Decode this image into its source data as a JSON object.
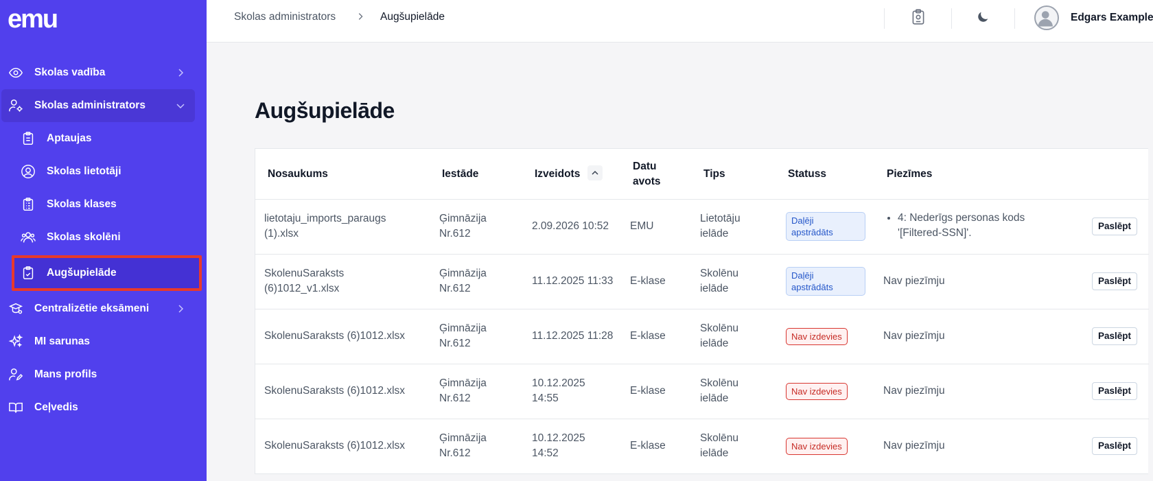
{
  "app": {
    "logo_text": "emu"
  },
  "sidebar": {
    "items": [
      {
        "label": "Skolas vadība",
        "icon": "eye-icon"
      },
      {
        "label": "Skolas administrators",
        "icon": "user-gear-icon"
      },
      {
        "label": "Aptaujas",
        "icon": "clipboard-icon"
      },
      {
        "label": "Skolas lietotāji",
        "icon": "user-circle-icon"
      },
      {
        "label": "Skolas klases",
        "icon": "clipboard-list-icon"
      },
      {
        "label": "Skolas skolēni",
        "icon": "users-icon"
      },
      {
        "label": "Augšupielāde",
        "icon": "clipboard-check-icon"
      },
      {
        "label": "Centralizētie eksāmeni",
        "icon": "exam-icon"
      },
      {
        "label": "MI sarunas",
        "icon": "sparkles-icon"
      },
      {
        "label": "Mans profils",
        "icon": "user-edit-icon"
      },
      {
        "label": "Ceļvedis",
        "icon": "book-icon"
      }
    ]
  },
  "topbar": {
    "breadcrumb": [
      "Skolas administrators",
      "Augšupielāde"
    ],
    "user_name": "Edgars Example"
  },
  "page": {
    "title": "Augšupielāde",
    "table": {
      "headers": {
        "name": "Nosaukums",
        "institution": "Iestāde",
        "created": "Izveidots",
        "source_l1": "Datu",
        "source_l2": "avots",
        "type": "Tips",
        "status": "Statuss",
        "notes": "Piezīmes"
      },
      "hide_label": "Paslēpt",
      "rows": [
        {
          "name_l1": "lietotaju_imports_paraugs",
          "name_l2": "(1).xlsx",
          "inst_l1": "Ģimnāzija",
          "inst_l2": "Nr.612",
          "created_l1": "2.09.2026 10:52",
          "created_l2": "",
          "source": "EMU",
          "type_l1": "Lietotāju",
          "type_l2": "ielāde",
          "status_l1": "Daļēji",
          "status_l2": "apstrādāts",
          "note_l1": "4: Nederīgs personas kods",
          "note_l2": "'[Filtered-SSN]'."
        },
        {
          "name_l1": "SkolenuSaraksts",
          "name_l2": "(6)1012_v1.xlsx",
          "inst_l1": "Ģimnāzija",
          "inst_l2": "Nr.612",
          "created_l1": "11.12.2025 11:33",
          "created_l2": "",
          "source": "E-klase",
          "type_l1": "Skolēnu",
          "type_l2": "ielāde",
          "status_l1": "Daļēji",
          "status_l2": "apstrādāts",
          "note": "Nav piezīmju"
        },
        {
          "name_l1": "SkolenuSaraksts (6)1012.xlsx",
          "inst_l1": "Ģimnāzija",
          "inst_l2": "Nr.612",
          "created_l1": "11.12.2025 11:28",
          "created_l2": "",
          "source": "E-klase",
          "type_l1": "Skolēnu",
          "type_l2": "ielāde",
          "status": "Nav izdevies",
          "note": "Nav piezīmju"
        },
        {
          "name_l1": "SkolenuSaraksts (6)1012.xlsx",
          "inst_l1": "Ģimnāzija",
          "inst_l2": "Nr.612",
          "created_l1": "10.12.2025",
          "created_l2": "14:55",
          "source": "E-klase",
          "type_l1": "Skolēnu",
          "type_l2": "ielāde",
          "status": "Nav izdevies",
          "note": "Nav piezīmju"
        },
        {
          "name_l1": "SkolenuSaraksts (6)1012.xlsx",
          "inst_l1": "Ģimnāzija",
          "inst_l2": "Nr.612",
          "created_l1": "10.12.2025",
          "created_l2": "14:52",
          "source": "E-klase",
          "type_l1": "Skolēnu",
          "type_l2": "ielāde",
          "status": "Nav izdevies",
          "note": "Nav piezīmju"
        }
      ]
    }
  },
  "colors": {
    "sidebar_bg": "#5140ed",
    "active_highlight": "#e8392b",
    "badge_partial": "#2456c9",
    "badge_fail": "#c62a24"
  }
}
